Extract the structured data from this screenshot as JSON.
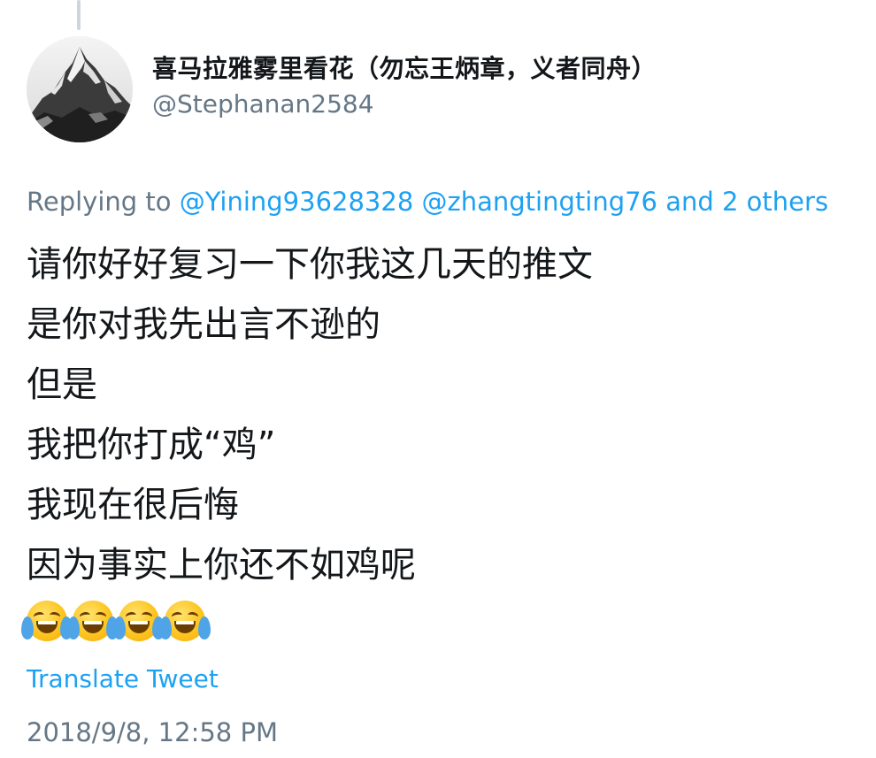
{
  "tweet": {
    "author": {
      "display_name": "喜马拉雅雾里看花（勿忘王炳章，义者同舟）",
      "handle": "@Stephanan2584",
      "avatar_icon": "mountain-avatar"
    },
    "reply": {
      "prefix": "Replying to",
      "mention_1": "@Yining93628328",
      "mention_2": "@zhangtingting76",
      "others": "and 2 others"
    },
    "lines": [
      "请你好好复习一下你我这几天的推文",
      "是你对我先出言不逊的",
      "但是",
      "我把你打成“鸡”",
      "我现在很后悔",
      "因为事实上你还不如鸡呢"
    ],
    "emoji": [
      "😂",
      "😂",
      "😂",
      "😂"
    ],
    "translate_label": "Translate Tweet",
    "timestamp": "2018/9/8, 12:58 PM"
  },
  "colors": {
    "link": "#1da1f2",
    "secondary_text": "#657786",
    "primary_text": "#14171a",
    "thread_line": "#ccd6dd"
  }
}
